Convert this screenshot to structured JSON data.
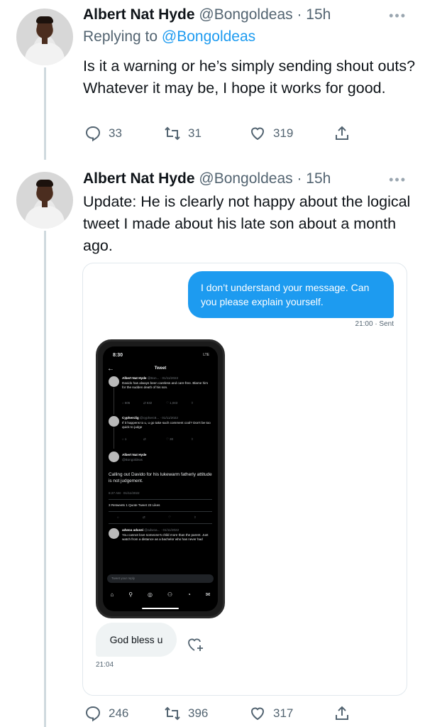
{
  "tweets": [
    {
      "name": "Albert Nat Hyde",
      "handle": "@Bongoldeas",
      "time": "· 15h",
      "more": "•••",
      "replying_label": "Replying to",
      "replying_handle": "@Bongoldeas",
      "text": "Is it a warning or he’s simply sending shout outs? Whatever it may be, I hope it works for good.",
      "replies": "33",
      "retweets": "31",
      "likes": "319"
    },
    {
      "name": "Albert Nat Hyde",
      "handle": "@Bongoldeas",
      "time": "· 15h",
      "more": "•••",
      "text": "Update: He is clearly not happy about the logical tweet I made about his late son about a month ago.",
      "replies": "246",
      "retweets": "396",
      "likes": "317"
    }
  ],
  "dm": {
    "sent_text": "I don’t understand your message. Can you please explain yourself.",
    "sent_meta": "21:00 · Sent",
    "received_text": "God bless u",
    "received_time": "21:04"
  },
  "phone": {
    "status_time": "8:30",
    "status_right": "LTE",
    "title": "Tweet",
    "t1_name": "Albert Nat Hyde",
    "t1_meta": "@Bon... · 01/11/2022",
    "t1_text": "Davido has always been careless and care-free. Blame him for the sudden death of his son.",
    "t1_replies": "606",
    "t1_rt": "632",
    "t1_likes": "1,043",
    "t2_name": "Cypherclig",
    "t2_meta": "@cypherc8... · 01/11/2022",
    "t2_text": "If it happens to u, u go take such comment cool? Don't be too quick to judge",
    "t2_replies": "1",
    "t2_likes": "30",
    "t3_name": "Albert Nat Hyde",
    "t3_handle": "@Bongoldeas",
    "main_text": "Calling out Davido for his lukewarm fatherly attitude is not judgement.",
    "main_time": "6:27 AM · 01/11/2022",
    "main_stats": "3 Retweets  1 Quote Tweet  23 Likes",
    "r_name": "adwoa adusei",
    "r_meta": "@adwoa... · 01/11/2022",
    "r_text": "You cannot love someone's child more than the parent. Just watch from a distance as a bachelor who has never had",
    "input_placeholder": "Tweet your reply"
  }
}
